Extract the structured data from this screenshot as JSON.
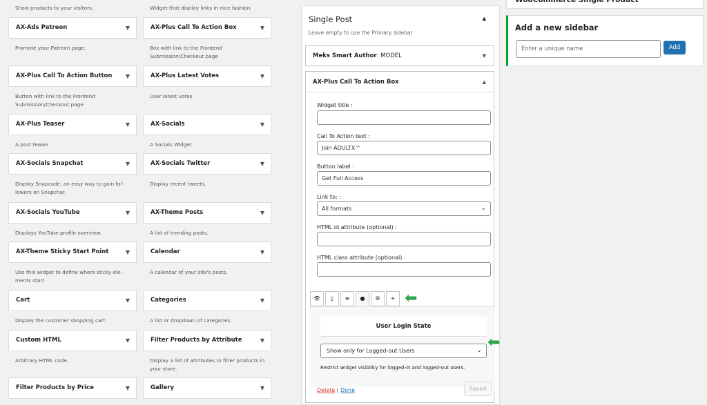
{
  "available_widgets": {
    "top_descs": [
      "Show products to your visitors.",
      "Widget that display links in nice fashion."
    ],
    "rows": [
      {
        "left": {
          "name": "AX-Ads Patreon",
          "desc": "Promote your Patreon page."
        },
        "right": {
          "name": "AX-Plus Call To Action Box",
          "desc": "Box with link to the Frontend Submission/Checkout page"
        }
      },
      {
        "left": {
          "name": "AX-Plus Call To Action Button",
          "desc": "Button with link to the Frontend Submission/Checkout page"
        },
        "right": {
          "name": "AX-Plus Latest Votes",
          "desc": "User latest votes"
        }
      },
      {
        "left": {
          "name": "AX-Plus Teaser",
          "desc": "A post teaser"
        },
        "right": {
          "name": "AX-Socials",
          "desc": "A Socials Widget"
        }
      },
      {
        "left": {
          "name": "AX-Socials Snapchat",
          "desc": "Display Snapcode, an easy way to gain fol-lowers on Snapchat"
        },
        "right": {
          "name": "AX-Socials Twitter",
          "desc": "Display recent tweets."
        }
      },
      {
        "left": {
          "name": "AX-Socials YouTube",
          "desc": "Displays YouTube profile overview."
        },
        "right": {
          "name": "AX-Theme Posts",
          "desc": "A list of trending posts."
        }
      },
      {
        "left": {
          "name": "AX-Theme Sticky Start Point",
          "desc": "Use this widget to define where sticky ele-ments start"
        },
        "right": {
          "name": "Calendar",
          "desc": "A calendar of your site's posts."
        }
      },
      {
        "left": {
          "name": "Cart",
          "desc": "Display the customer shopping cart."
        },
        "right": {
          "name": "Categories",
          "desc": "A list or dropdown of categories."
        }
      },
      {
        "left": {
          "name": "Custom HTML",
          "desc": "Arbitrary HTML code."
        },
        "right": {
          "name": "Filter Products by Attribute",
          "desc": "Display a list of attributes to filter products in your store."
        }
      },
      {
        "left": {
          "name": "Filter Products by Price",
          "desc": ""
        },
        "right": {
          "name": "Gallery",
          "desc": ""
        }
      }
    ]
  },
  "sidebar": {
    "title": "Single Post",
    "subtitle": "Leave empty to use the Primary sidebar",
    "widget1": {
      "name": "Meks Smart Author",
      "sub": ": MODEL"
    },
    "widget2": {
      "name": "AX-Plus Call To Action Box",
      "fields": {
        "widget_title_label": "Widget title :",
        "widget_title_value": "",
        "cta_text_label": "Call To Action text :",
        "cta_text_value": "Join ADULTX™",
        "button_label_label": "Button label :",
        "button_label_value": "Get Full Access",
        "link_to_label": "Link to: :",
        "link_to_value": "All formats",
        "html_id_label": "HTML id attribute (optional) :",
        "html_id_value": "",
        "html_class_label": "HTML class attribute (optional) :",
        "html_class_value": ""
      },
      "tabs": [
        "eye-icon",
        "mobile-icon",
        "align-icon",
        "user-icon",
        "gear-icon",
        "plus-icon"
      ],
      "visibility": {
        "title": "User Login State",
        "select_value": "Show only for Logged-out Users",
        "note": "Restrict widget visibility for logged-in and logged-out users."
      },
      "delete_label": "Delete",
      "separator": "|",
      "done_label": "Done",
      "saved_label": "Saved"
    }
  },
  "right": {
    "wc_title": "WooCommerce Single Product",
    "add_sidebar_title": "Add a new sidebar",
    "add_placeholder": "Enter a unique name",
    "add_button": "Add"
  },
  "colors": {
    "accent": "#2271b1",
    "green": "#00a32a",
    "delete": "#d63638"
  }
}
